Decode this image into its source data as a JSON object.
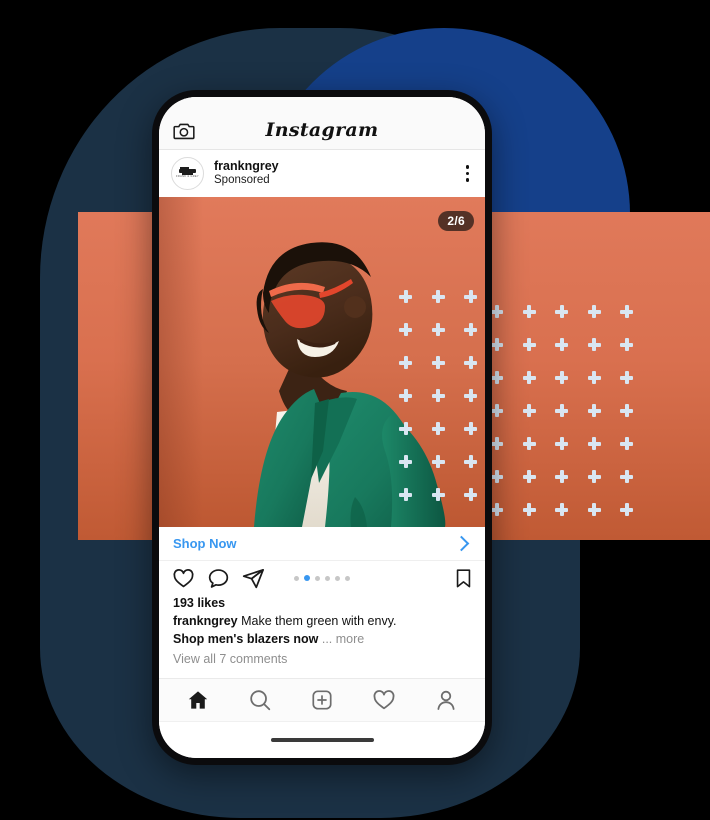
{
  "meta": {
    "scene": "instagram-sponsored-carousel-post-mockup",
    "colors": {
      "navy_blob": "#1b3145",
      "blue_circle": "#15408a",
      "orange_band_top": "#e0795a",
      "orange_band_bottom": "#c05a34",
      "accent_link": "#3897f0",
      "blazer_green": "#1a7f62",
      "sunglasses_red": "#e2462c",
      "plus_pattern": "#d9e6f2"
    }
  },
  "phone": {
    "topbar": {
      "camera_icon": "camera-icon",
      "wordmark": "Instagram"
    },
    "post_header": {
      "avatar_icon": "brand-avatar-frank-and-grey",
      "username": "frankngrey",
      "subtitle": "Sponsored",
      "menu_icon": "more-options-icon"
    },
    "media": {
      "carousel_badge": "2/6",
      "description": "Man in green blazer with red sunglasses on orange backdrop",
      "pattern_icon": "plus-pattern"
    },
    "shop_now": {
      "label": "Shop Now",
      "chevron_icon": "chevron-right-icon"
    },
    "actions": {
      "like_icon": "heart-icon",
      "comment_icon": "comment-bubble-icon",
      "share_icon": "paper-plane-icon",
      "save_icon": "bookmark-icon",
      "carousel_total": 6,
      "carousel_active_index": 2
    },
    "caption": {
      "likes": "193 likes",
      "author": "frankngrey",
      "text_line1": "Make them green with envy.",
      "text_line2": "Shop men's blazers now",
      "ellipsis": "...",
      "more_label": "more",
      "comments": "View all 7 comments"
    },
    "bottom_nav": {
      "items": [
        {
          "name": "home-icon",
          "label": "Home"
        },
        {
          "name": "search-icon",
          "label": "Search"
        },
        {
          "name": "add-post-icon",
          "label": "Add"
        },
        {
          "name": "activity-heart-icon",
          "label": "Activity"
        },
        {
          "name": "profile-icon",
          "label": "Profile"
        }
      ]
    },
    "home_indicator": "home-indicator-bar"
  }
}
